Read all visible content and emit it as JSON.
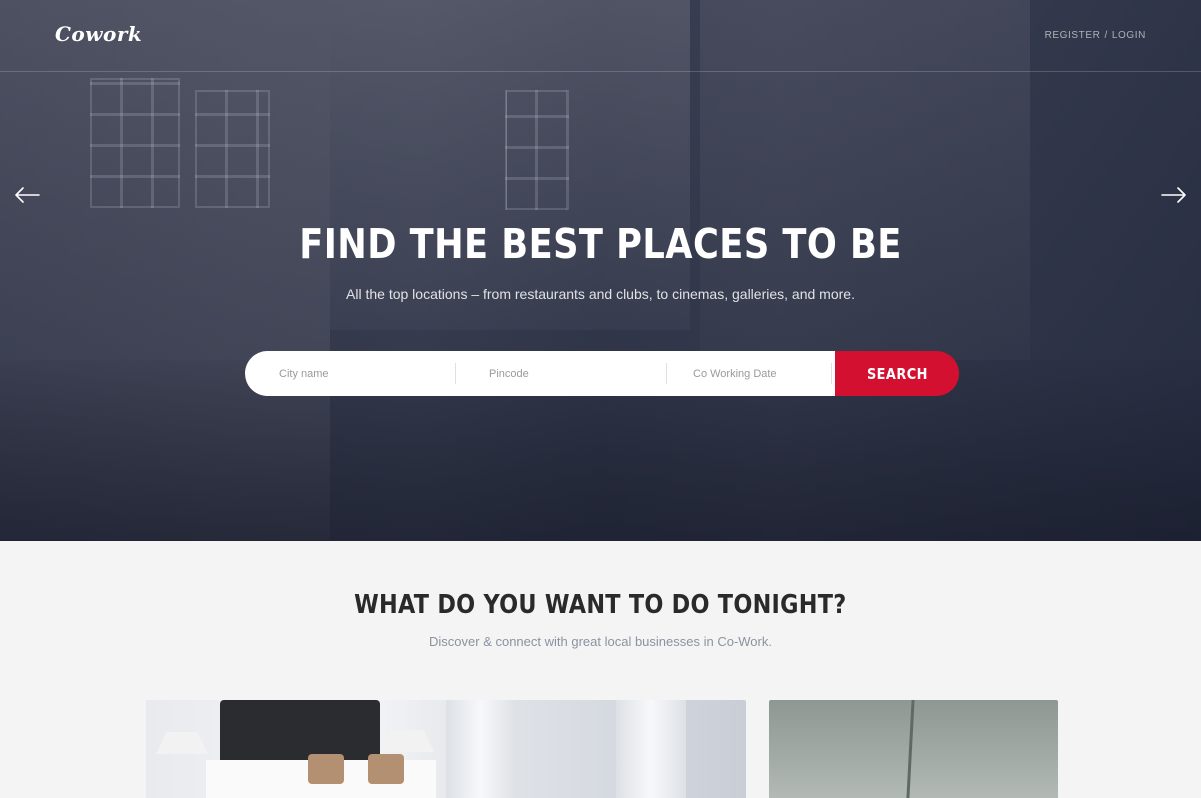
{
  "brand": {
    "logo": "Cowork"
  },
  "nav": {
    "register": "REGISTER",
    "separator": "/",
    "login": "LOGIN"
  },
  "hero": {
    "title": "FIND THE BEST PLACES TO BE",
    "subtitle": "All the top locations – from restaurants and clubs, to cinemas, galleries, and more."
  },
  "search": {
    "city_placeholder": "City name",
    "pincode_placeholder": "Pincode",
    "date_placeholder": "Co Working Date",
    "button_label": "SEARCH"
  },
  "section": {
    "title": "WHAT DO YOU WANT TO DO TONIGHT?",
    "subtitle": "Discover & connect with great local businesses in Co-Work."
  },
  "colors": {
    "accent": "#d3102f",
    "hero_overlay": "#262c42",
    "page_bg": "#f4f4f4"
  },
  "icons": {
    "prev": "arrow-left-icon",
    "next": "arrow-right-icon"
  }
}
